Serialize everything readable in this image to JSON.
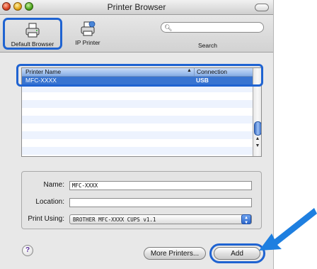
{
  "window": {
    "title": "Printer Browser"
  },
  "toolbar": {
    "default_browser_label": "Default Browser",
    "ip_printer_label": "IP Printer",
    "search_label": "Search",
    "search_placeholder": "",
    "search_value": ""
  },
  "printer_list": {
    "columns": [
      "Printer Name",
      "Connection"
    ],
    "rows": [
      {
        "name": "MFC-XXXX",
        "connection": "USB",
        "selected": true
      }
    ]
  },
  "form": {
    "name_label": "Name:",
    "name_value": "MFC-XXXX",
    "location_label": "Location:",
    "location_value": "",
    "print_using_label": "Print Using:",
    "print_using_value": "BROTHER MFC-XXXX CUPS v1.1"
  },
  "buttons": {
    "help_label": "?",
    "more_printers_label": "More Printers...",
    "add_label": "Add"
  },
  "colors": {
    "highlight_blue": "#1f63d1",
    "selection_blue": "#3874d1",
    "callout_arrow": "#1e7fe0"
  }
}
